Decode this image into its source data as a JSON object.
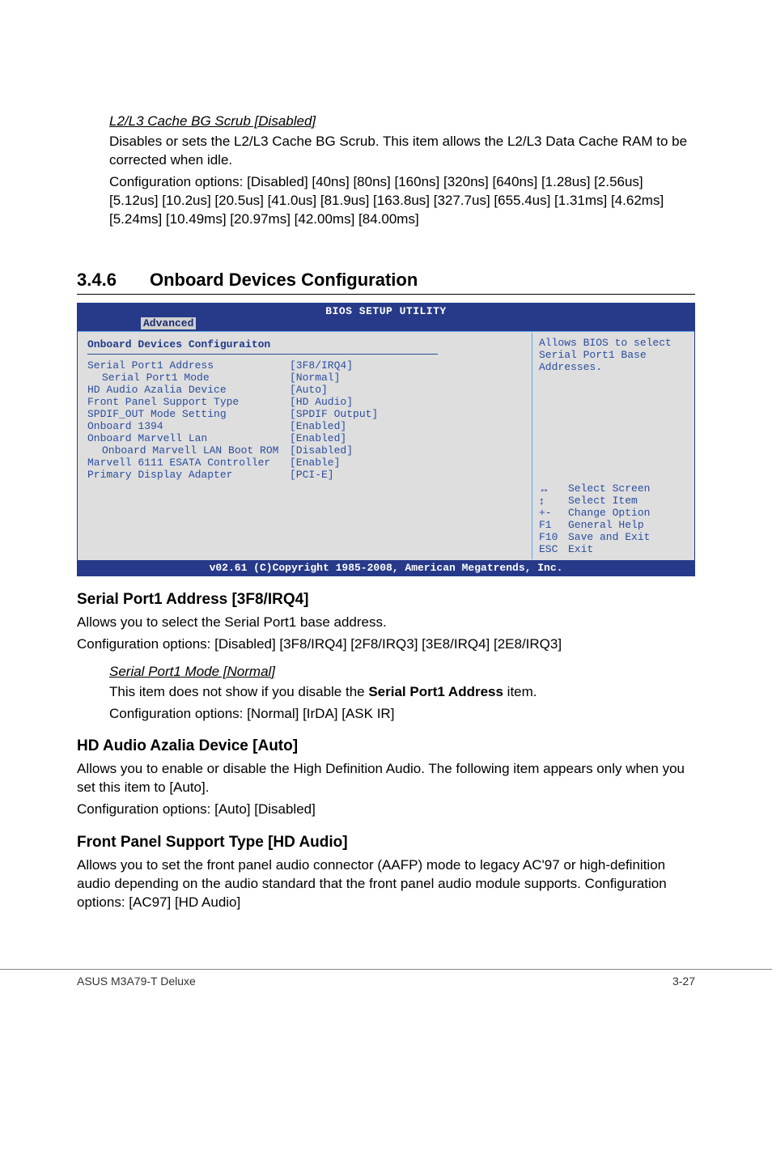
{
  "top_section": {
    "sub_heading": "L2/L3 Cache BG Scrub [Disabled]",
    "para1": "Disables or sets the L2/L3 Cache BG Scrub. This item allows the L2/L3 Data Cache RAM to be corrected when idle.",
    "para2": "Configuration options: [Disabled] [40ns] [80ns] [160ns] [320ns] [640ns] [1.28us] [2.56us] [5.12us] [10.2us] [20.5us] [41.0us] [81.9us] [163.8us] [327.7us] [655.4us] [1.31ms] [4.62ms] [5.24ms] [10.49ms] [20.97ms] [42.00ms] [84.00ms]"
  },
  "section_346": {
    "num": "3.4.6",
    "title": "Onboard Devices Configuration"
  },
  "bios": {
    "title": "BIOS SETUP UTILITY",
    "tab": "Advanced",
    "panel_title": "Onboard Devices Configuraiton",
    "items": [
      {
        "label": "Serial Port1 Address",
        "value": "[3F8/IRQ4]",
        "sub": false
      },
      {
        "label": "Serial Port1 Mode",
        "value": "[Normal]",
        "sub": true
      },
      {
        "label": "HD Audio Azalia Device",
        "value": "[Auto]",
        "sub": false
      },
      {
        "label": "Front Panel Support Type",
        "value": "[HD Audio]",
        "sub": false
      },
      {
        "label": "SPDIF_OUT Mode Setting",
        "value": "[SPDIF Output]",
        "sub": false
      },
      {
        "label": "Onboard 1394",
        "value": "[Enabled]",
        "sub": false
      },
      {
        "label": "Onboard Marvell Lan",
        "value": "[Enabled]",
        "sub": false
      },
      {
        "label": "Onboard Marvell LAN Boot ROM",
        "value": "[Disabled]",
        "sub": true
      },
      {
        "label": "Marvell 6111 ESATA Controller",
        "value": "[Enable]",
        "sub": false
      },
      {
        "label": "Primary Display Adapter",
        "value": "[PCI-E]",
        "sub": false
      }
    ],
    "help_text": "Allows BIOS to select Serial Port1 Base Addresses.",
    "nav": [
      {
        "icon": "↔",
        "label": "Select Screen"
      },
      {
        "icon": "↕",
        "label": "Select Item"
      },
      {
        "icon": "+-",
        "label": "Change Option"
      },
      {
        "icon": "F1",
        "label": "General Help"
      },
      {
        "icon": "F10",
        "label": "Save and Exit"
      },
      {
        "icon": "ESC",
        "label": "Exit"
      }
    ],
    "footer": "v02.61 (C)Copyright 1985-2008, American Megatrends, Inc."
  },
  "serial_port1": {
    "heading": "Serial Port1 Address [3F8/IRQ4]",
    "p1": "Allows you to select the Serial Port1 base address.",
    "p2": "Configuration options: [Disabled] [3F8/IRQ4] [2F8/IRQ3] [3E8/IRQ4] [2E8/IRQ3]",
    "mode_heading": "Serial Port1 Mode [Normal]",
    "mode_p1_a": "This item does not show if you disable the ",
    "mode_p1_b": "Serial Port1 Address",
    "mode_p1_c": " item.",
    "mode_p2": "Configuration options: [Normal] [IrDA] [ASK IR]"
  },
  "hd_audio": {
    "heading": "HD Audio Azalia Device [Auto]",
    "p1": "Allows you to enable or disable the High Definition Audio. The following item appears only when you set this item to [Auto].",
    "p2": "Configuration options: [Auto] [Disabled]"
  },
  "front_panel": {
    "heading": "Front Panel Support Type [HD Audio]",
    "p1": "Allows you to set the front panel audio connector (AAFP) mode to legacy AC'97 or high-definition audio depending on the audio standard that the front panel audio module supports. Configuration options: [AC97] [HD Audio]"
  },
  "footer": {
    "left": "ASUS M3A79-T Deluxe",
    "right": "3-27"
  }
}
